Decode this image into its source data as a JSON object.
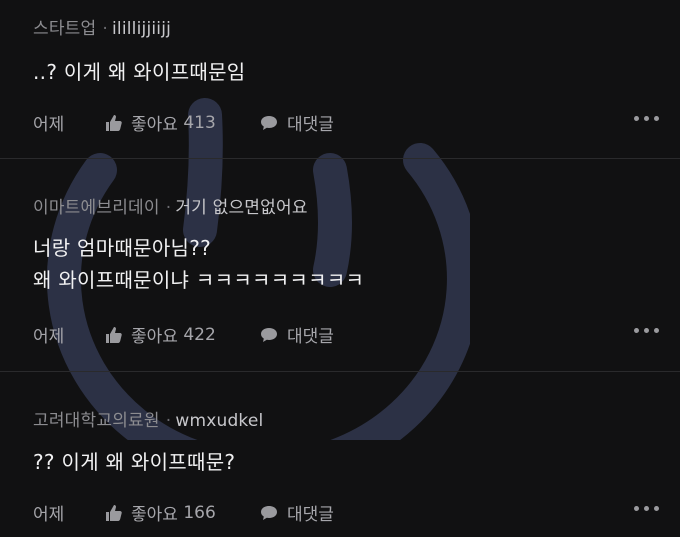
{
  "comments": [
    {
      "author": "스타트업",
      "reply_to": "ilillijjiijj",
      "lines": [
        "..? 이게 왜 와이프때문임"
      ],
      "time": "어제",
      "like_label": "좋아요",
      "like_count": "413",
      "reply_label": "대댓글"
    },
    {
      "author": "이마트에브리데이",
      "reply_to": "거기 없으면없어요",
      "lines": [
        "너랑 엄마때문아님??",
        "왜 와이프때문이냐 ㅋㅋㅋㅋㅋㅋㅋㅋㅋ"
      ],
      "time": "어제",
      "like_label": "좋아요",
      "like_count": "422",
      "reply_label": "대댓글"
    },
    {
      "author": "고려대학교의료원",
      "reply_to": "wmxudkel",
      "lines": [
        "?? 이게 왜 와이프때문?"
      ],
      "time": "어제",
      "like_label": "좋아요",
      "like_count": "166",
      "reply_label": "대댓글"
    }
  ],
  "colors": {
    "background": "#111112",
    "text": "#f1f1f2",
    "meta": "#8c8c90",
    "watermark": "#2e3347"
  },
  "icons": [
    "thumbs-up-icon",
    "speech-bubble-icon",
    "more-dots-icon",
    "smiley-watermark"
  ]
}
